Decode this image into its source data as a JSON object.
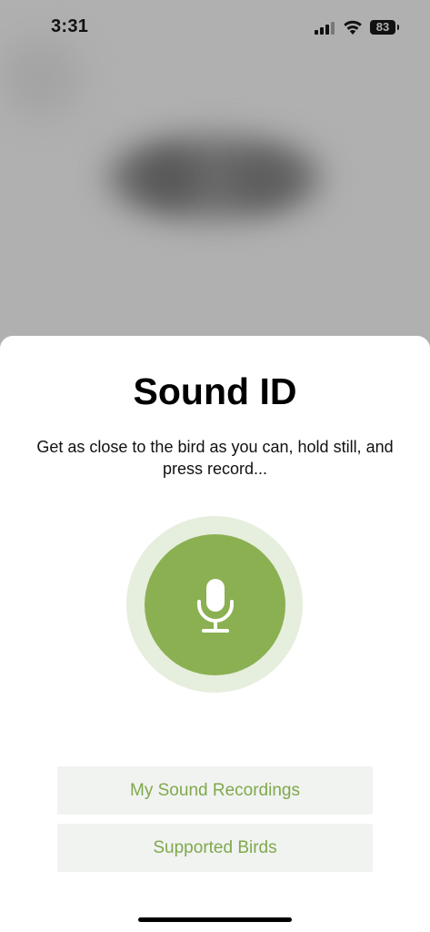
{
  "status_bar": {
    "time": "3:31",
    "battery_level": "83",
    "signal_bars": 3,
    "icons": [
      "signal-icon",
      "wifi-icon",
      "battery-icon"
    ]
  },
  "sheet": {
    "title": "Sound ID",
    "subtitle": "Get as close to the bird as you can, hold still, and press record...",
    "record_button": {
      "icon": "microphone-icon"
    },
    "buttons": {
      "recordings_label": "My Sound Recordings",
      "supported_birds_label": "Supported Birds"
    }
  },
  "colors": {
    "accent_green": "#8ab052",
    "halo_green": "#e6eedd",
    "button_text_green": "#80a84c",
    "button_background": "#f1f3f1"
  }
}
